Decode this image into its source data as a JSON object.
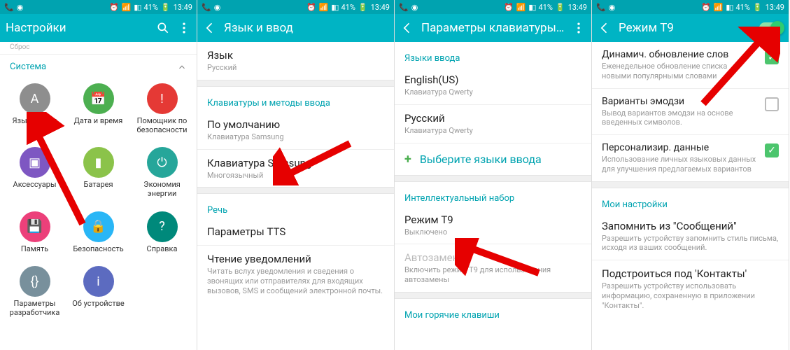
{
  "status": {
    "battery": "41%",
    "time": "13:49"
  },
  "s1": {
    "title": "Настройки",
    "crumb": "Сброс",
    "section": "Система",
    "items": [
      {
        "label": "Язык и ввод",
        "color": "#8e8e8e",
        "glyph": "A"
      },
      {
        "label": "Дата и время",
        "color": "#4caf50",
        "glyph": "📅"
      },
      {
        "label": "Помощник по безопасности",
        "color": "#e53935",
        "glyph": "!"
      },
      {
        "label": "Аксессуары",
        "color": "#7e57c2",
        "glyph": "▣"
      },
      {
        "label": "Батарея",
        "color": "#8bc34a",
        "glyph": "▮"
      },
      {
        "label": "Экономия энергии",
        "color": "#26a69a",
        "glyph": "⏻"
      },
      {
        "label": "Память",
        "color": "#ec407a",
        "glyph": "💾"
      },
      {
        "label": "Безопасность",
        "color": "#29b6f6",
        "glyph": "🔒"
      },
      {
        "label": "Справка",
        "color": "#00897b",
        "glyph": "?"
      },
      {
        "label": "Параметры разработчика",
        "color": "#78909c",
        "glyph": "{}"
      },
      {
        "label": "Об устройстве",
        "color": "#5c6bc0",
        "glyph": "i"
      }
    ]
  },
  "s2": {
    "title": "Язык и ввод",
    "lang_section": "Язык",
    "lang_value": "Русский",
    "kbd_section": "Клавиатуры и методы ввода",
    "default_label": "По умолчанию",
    "default_value": "Клавиатура Samsung",
    "samsung_label": "Клавиатура Samsung",
    "samsung_value": "Многоязычный",
    "speech_section": "Речь",
    "tts_label": "Параметры TTS",
    "read_notif_label": "Чтение уведомлений",
    "read_notif_desc": "Читать вслух уведомления и сведения о звонящих или отправителях для входящих вызовов, SMS и сообщений электронной почты."
  },
  "s3": {
    "title": "Параметры клавиатуры...",
    "input_lang_section": "Языки ввода",
    "en_label": "English(US)",
    "en_sub": "Клавиатура Qwerty",
    "ru_label": "Русский",
    "ru_sub": "Клавиатура Qwerty",
    "add_lang": "Выберите языки ввода",
    "smart_section": "Интеллектуальный набор",
    "t9_label": "Режим T9",
    "t9_value": "Выключено",
    "auto_label": "Автозамена",
    "auto_desc": "Включить режим T9 для использования автозамены",
    "hotkeys_section": "Мои горячие клавиши"
  },
  "s4": {
    "title": "Режим T9",
    "dyn_label": "Динамич. обновление слов",
    "dyn_desc": "Еженедельное обновление списка новыми популярными словами",
    "emoji_label": "Варианты эмодзи",
    "emoji_desc": "Вывод вариантов эмодзи на основе введенных символов.",
    "pers_label": "Персонализир. данные",
    "pers_desc": "Использование личных языковых данных для улучшения предлагаемых вариантов",
    "my_section": "Мои настройки",
    "msg_label": "Запомнить из \"Сообщений\"",
    "msg_desc": "Разрешить устройству запомнить стиль письма, исходя из ваших сообщений.",
    "cont_label": "Подстроиться под 'Контакты'",
    "cont_desc": "Разрешить устройству использовать информацию, сохраненную в приложении \"Контакты\"."
  }
}
